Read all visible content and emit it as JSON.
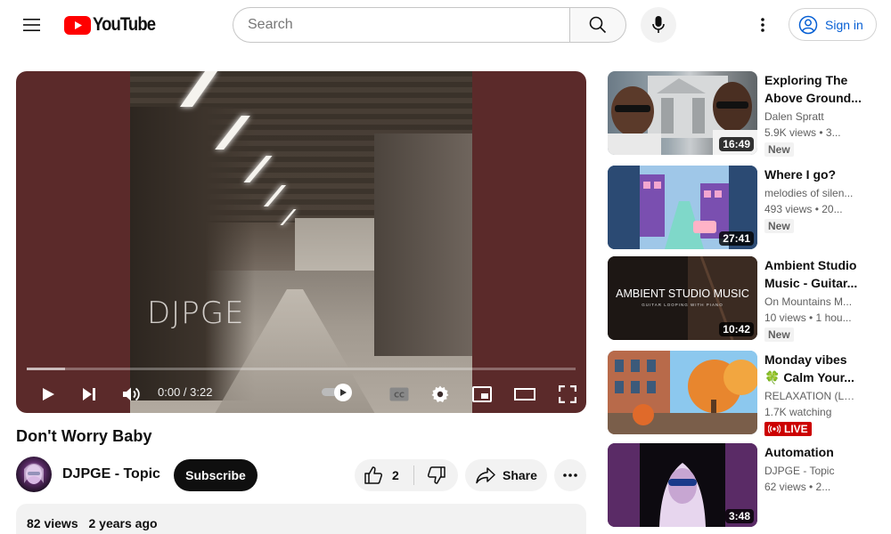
{
  "header": {
    "logo_text": "YouTube",
    "search_placeholder": "Search",
    "search_value": "",
    "signin_label": "Sign in"
  },
  "player": {
    "overlay_text": "DJPGE",
    "time_current": "0:00",
    "time_total": "3:22",
    "time_display": "0:00 / 3:22",
    "buffered_fraction": 0.07
  },
  "video": {
    "title": "Don't Worry Baby",
    "channel": "DJPGE - Topic",
    "subscribe_label": "Subscribe",
    "like_count": "2",
    "share_label": "Share",
    "views": "82 views",
    "age": "2 years ago"
  },
  "recommendations": [
    {
      "title_line1": "Exploring The",
      "title_line2": "Above Ground...",
      "channel": "Dalen Spratt",
      "stats": "5.9K views • 3...",
      "badge": "New",
      "duration": "16:49"
    },
    {
      "title_line1": "Where I go?",
      "title_line2": "",
      "channel": "melodies of silen...",
      "stats": "493 views • 20...",
      "badge": "New",
      "duration": "27:41"
    },
    {
      "title_line1": "Ambient Studio",
      "title_line2": "Music - Guitar...",
      "channel": "On Mountains M...",
      "stats": "10 views • 1 hou...",
      "badge": "New",
      "duration": "10:42",
      "thumb_title": "AMBIENT STUDIO MUSIC",
      "thumb_subtitle": "GUITAR LOOPING WITH PIANO"
    },
    {
      "title_line1": "Monday vibes",
      "title_line2": "🍀 Calm Your...",
      "channel": "RELAXATION (Lo...",
      "stats": "1.7K watching",
      "badge": "LIVE"
    },
    {
      "title_line1": "Automation",
      "title_line2": "",
      "channel": "DJPGE - Topic",
      "stats": "62 views • 2...",
      "duration": "3:48"
    }
  ],
  "colors": {
    "brand_red": "#ff0000",
    "link_blue": "#065fd4",
    "live_red": "#cc0000",
    "player_bg": "#5b2a2a"
  },
  "icons": [
    "menu-icon",
    "youtube-logo-icon",
    "search-icon",
    "mic-icon",
    "more-vert-icon",
    "account-icon",
    "play-icon",
    "next-icon",
    "volume-icon",
    "autoplay-toggle",
    "cc-icon",
    "settings-icon",
    "miniplayer-icon",
    "theater-icon",
    "fullscreen-icon",
    "like-icon",
    "dislike-icon",
    "share-icon",
    "more-horiz-icon",
    "live-icon"
  ]
}
